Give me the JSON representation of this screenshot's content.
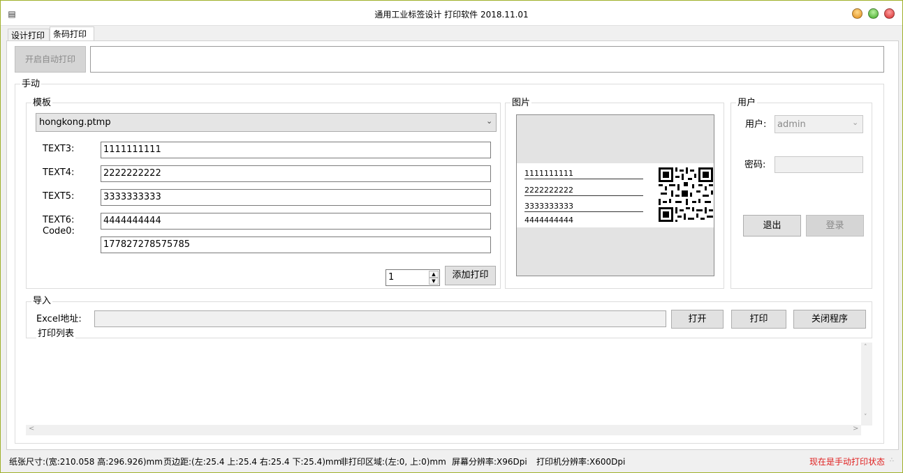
{
  "window": {
    "title": "通用工业标签设计 打印软件    2018.11.01",
    "icon": "app-icon"
  },
  "tabs": [
    {
      "label": "设计打印"
    },
    {
      "label": "条码打印"
    }
  ],
  "top": {
    "auto_print_button": "开启自动打印",
    "status_value": ""
  },
  "manual": {
    "label": "手动",
    "template": {
      "label": "模板",
      "selected": "hongkong.ptmp",
      "fields": [
        {
          "label": "TEXT3:",
          "value": "1111111111"
        },
        {
          "label": "TEXT4:",
          "value": "2222222222"
        },
        {
          "label": "TEXT5:",
          "value": "3333333333"
        },
        {
          "label": "TEXT6:",
          "value": "4444444444"
        },
        {
          "label": "Code0:",
          "value": "177827278575785"
        }
      ],
      "quantity": "1",
      "add_print_button": "添加打印"
    },
    "image": {
      "label": "图片",
      "preview_lines": [
        "1111111111",
        "2222222222",
        "3333333333",
        "4444444444"
      ],
      "qr_icon": "qr-code-icon"
    },
    "user": {
      "label": "用户",
      "user_label": "用户:",
      "user_value": "admin",
      "password_label": "密码:",
      "password_value": "",
      "logout_button": "退出",
      "login_button": "登录"
    }
  },
  "import": {
    "label": "导入",
    "excel_label": "Excel地址:",
    "excel_value": "",
    "open_button": "打开",
    "print_button": "打印",
    "close_button": "关闭程序"
  },
  "print_list": {
    "label": "打印列表"
  },
  "status": {
    "paper": "纸张尺寸:(宽:210.058 高:296.926)mm",
    "margin": "页边距:(左:25.4 上:25.4 右:25.4 下:25.4)mm",
    "nonprint": "非打印区域:(左:0, 上:0)mm",
    "screen_dpi": "屏幕分辨率:X96Dpi",
    "printer_dpi": "打印机分辨率:X600Dpi",
    "mode": "现在是手动打印状态",
    "mode_color": "#e02020"
  }
}
